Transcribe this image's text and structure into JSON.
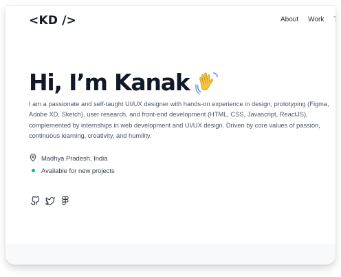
{
  "header": {
    "logo": "<KD />",
    "nav": [
      {
        "label": "About"
      },
      {
        "label": "Work"
      },
      {
        "label": "T"
      }
    ]
  },
  "hero": {
    "greeting": "Hi, I’m Kanak",
    "emoji_icon": "waving-hand-icon",
    "bio": "I am a passionate and self-taught UI/UX designer with hands-on experience in design, prototyping (Figma, Adobe XD, Sketch), user research, and front-end development (HTML, CSS, Javascript, ReactJS), complemented by internships in web development and UI/UX design. Driven by core values of passion, continuous learning, creativity, and humility."
  },
  "meta": {
    "location": "Madhya Pradesh, India",
    "availability": "Available for new projects",
    "availability_color": "#10b981"
  },
  "socials": [
    {
      "icon": "github-icon"
    },
    {
      "icon": "twitter-icon"
    },
    {
      "icon": "figma-icon"
    }
  ],
  "colors": {
    "text_dark": "#111827",
    "text_body": "#4b5563",
    "footer_bg": "#f8f9fb"
  }
}
